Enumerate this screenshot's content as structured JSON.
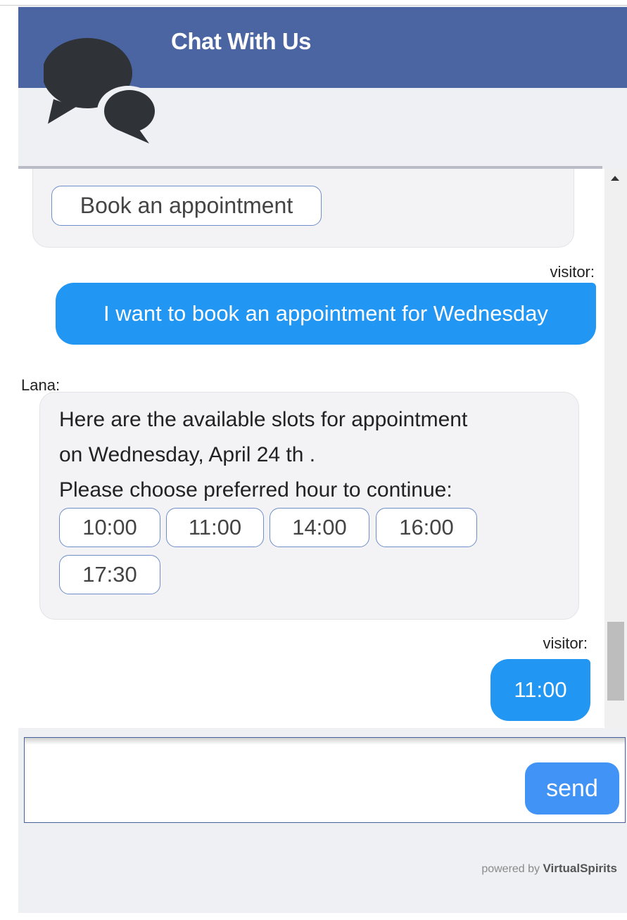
{
  "header": {
    "title": "Chat With Us",
    "icon": "chat-bubbles-icon"
  },
  "messages": {
    "bot_option_button": "Book an appointment",
    "visitor_label_1": "visitor:",
    "visitor_message_1": "I want to book an appointment for Wednesday",
    "bot_name_label": "Lana:",
    "bot_message_lines": [
      "Here are the available slots for appointment",
      "on Wednesday, April 24 th .",
      "Please choose preferred hour to continue:"
    ],
    "time_slots": [
      "10:00",
      "11:00",
      "14:00",
      "16:00",
      "17:30"
    ],
    "visitor_label_2": "visitor:",
    "visitor_message_2": "11:00"
  },
  "input": {
    "placeholder": "",
    "send_label": "send"
  },
  "footer": {
    "powered_prefix": "powered by",
    "brand": "VirtualSpirits"
  },
  "colors": {
    "header_bg": "#4b65a3",
    "visitor_bubble": "#2196f3",
    "send_button": "#4193f5"
  }
}
